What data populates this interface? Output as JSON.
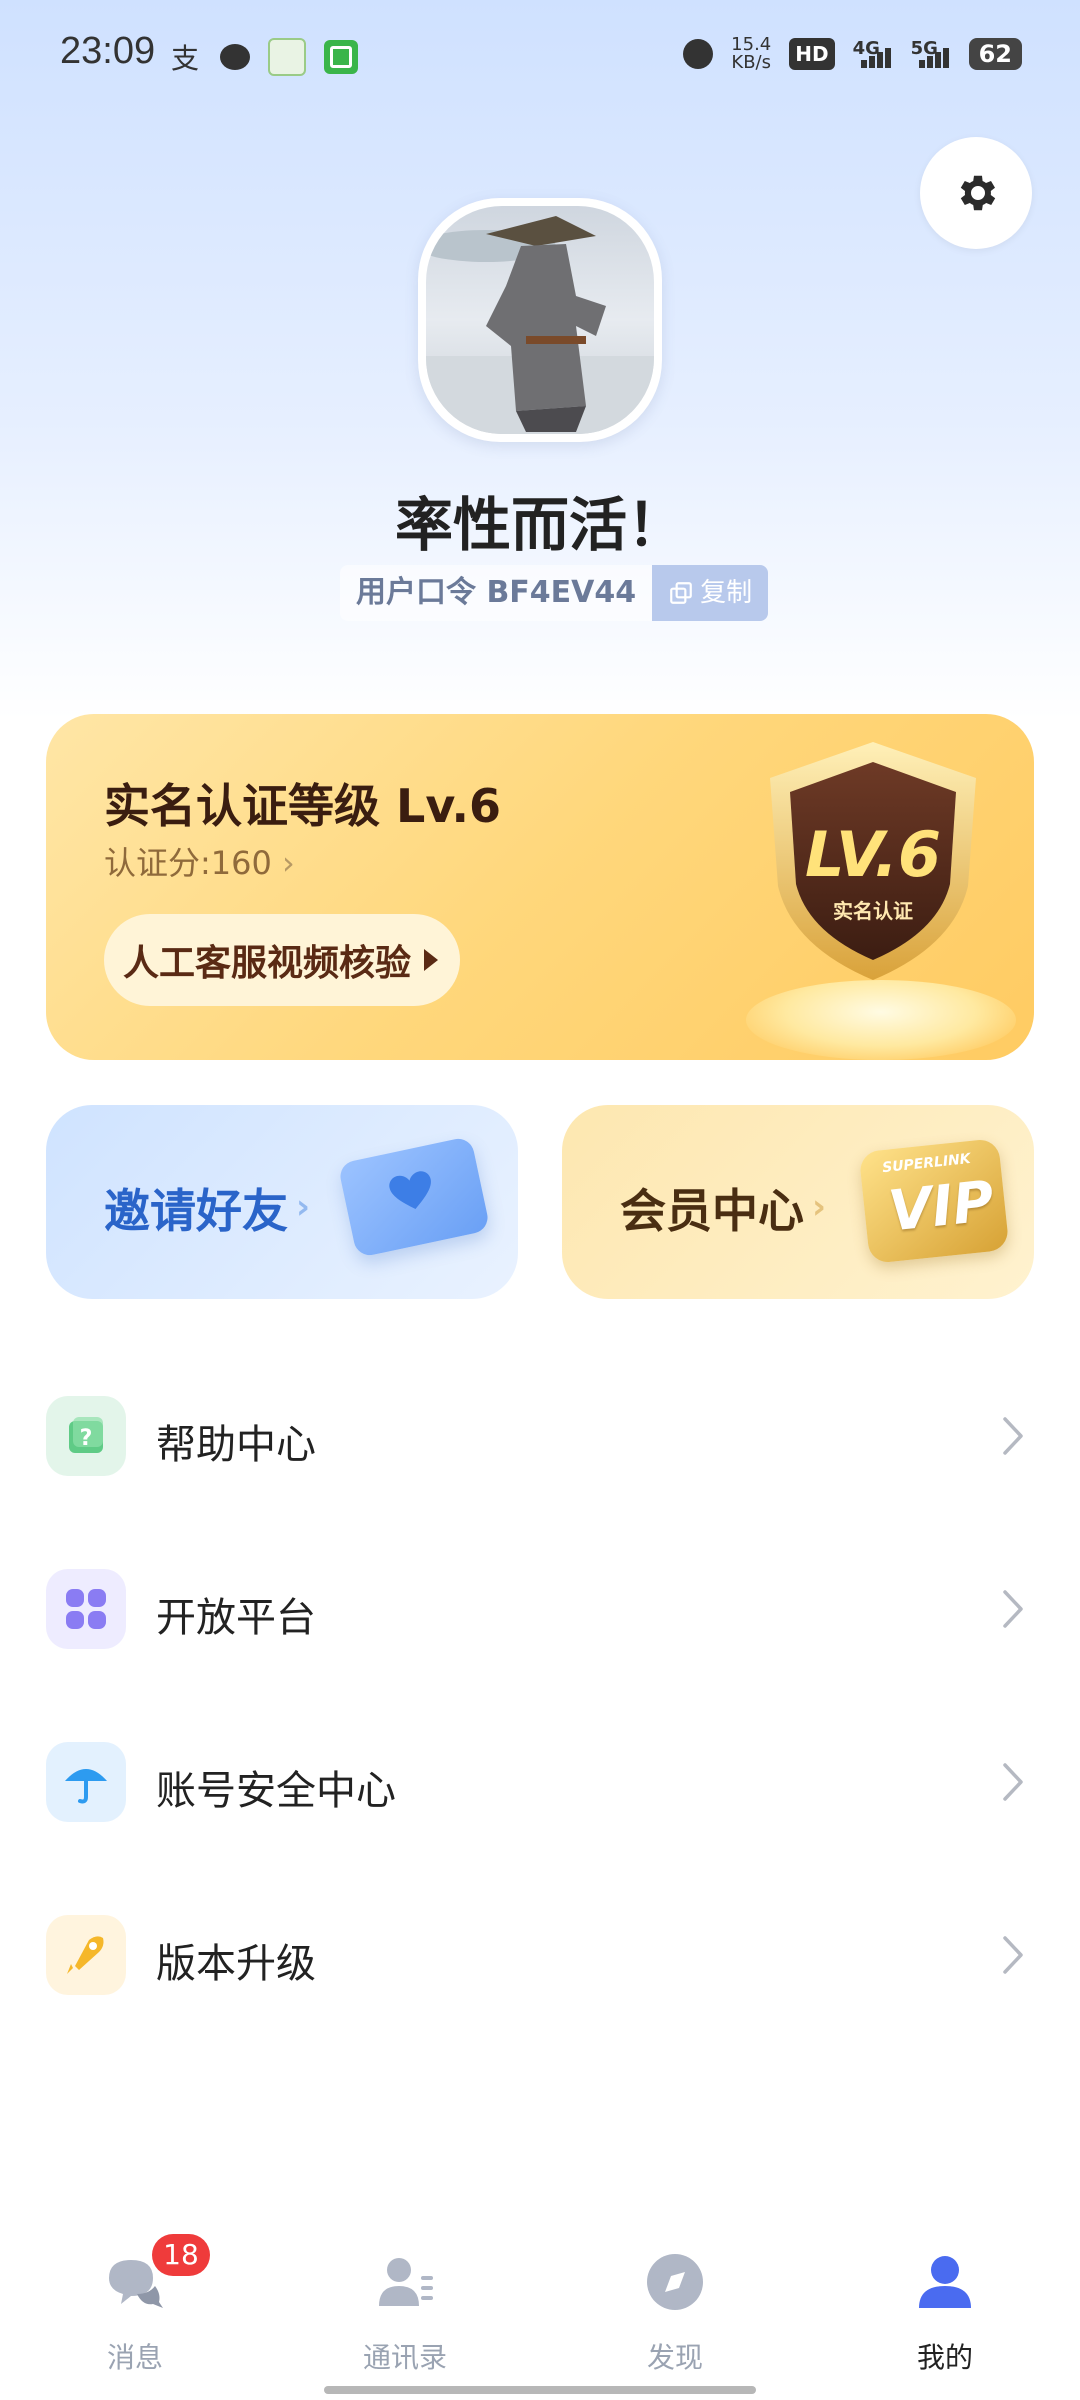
{
  "status_bar": {
    "time": "23:09",
    "net_speed_value": "15.4",
    "net_speed_unit": "KB/s",
    "hd_label": "HD",
    "net_4g": "4G",
    "net_5g": "5G",
    "battery": "62"
  },
  "profile": {
    "nickname": "率性而活！",
    "user_code_label": "用户口令 BF4EV44",
    "copy_label": "复制"
  },
  "verification": {
    "title": "实名认证等级 Lv.6",
    "score_label": "认证分:160",
    "video_check_button": "人工客服视频核验",
    "shield_level": "LV.6",
    "shield_caption": "实名认证"
  },
  "tiles": {
    "invite_label": "邀请好友",
    "vip_label": "会员中心",
    "vip_badge_text": "VIP",
    "vip_badge_super": "SUPERLINK"
  },
  "menu": [
    {
      "label": "帮助中心",
      "icon": "help-question-icon"
    },
    {
      "label": "开放平台",
      "icon": "apps-grid-icon"
    },
    {
      "label": "账号安全中心",
      "icon": "umbrella-shield-icon"
    },
    {
      "label": "版本升级",
      "icon": "rocket-upgrade-icon"
    }
  ],
  "bottom_nav": {
    "messages_label": "消息",
    "messages_badge": "18",
    "contacts_label": "通讯录",
    "discover_label": "发现",
    "me_label": "我的"
  },
  "colors": {
    "accent_blue": "#2a64c9",
    "active_nav": "#4a6bf0",
    "badge_red": "#ef3b3b"
  }
}
